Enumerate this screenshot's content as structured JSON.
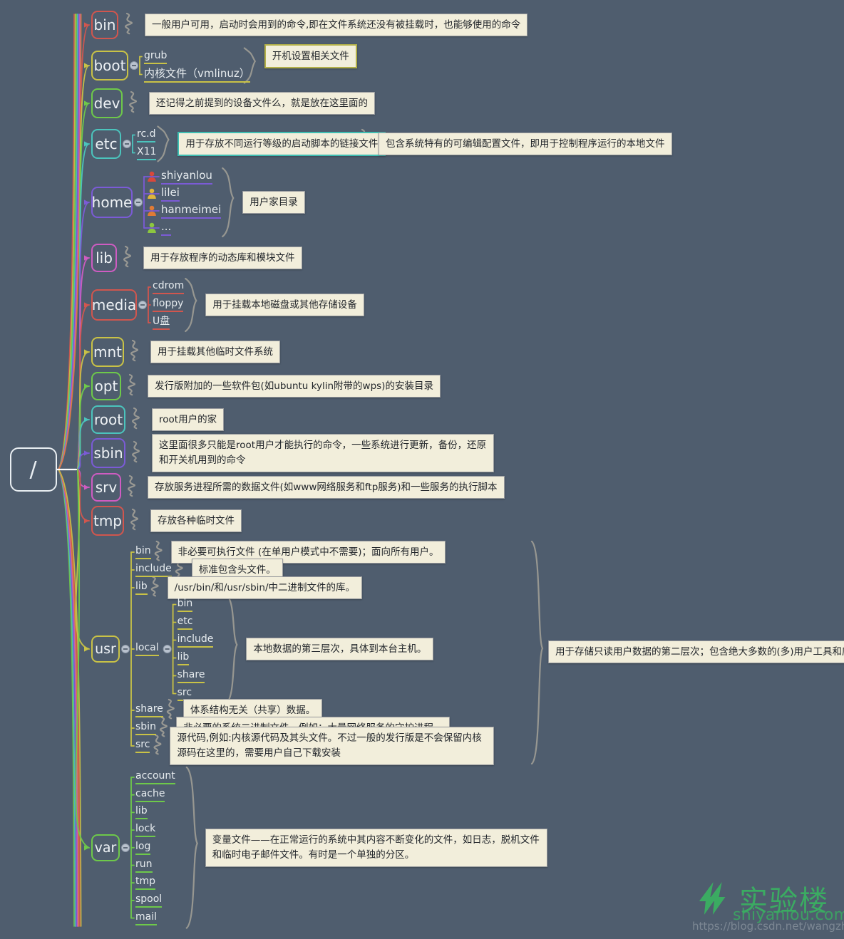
{
  "meta": {
    "background_color": "#4f5d6e",
    "root_label": "/",
    "note_fill": "#f2eedb"
  },
  "watermark": {
    "brand": "实验楼",
    "site": "shiyanlou.com",
    "blog_url": "https://blog.csdn.net/wangzhae"
  },
  "nodes": [
    {
      "id": "bin",
      "label": "bin",
      "color": "#d1564e",
      "children": [],
      "note": "一般用户可用，启动时会用到的命令,即在文件系统还没有被挂载时，也能够使用的命令",
      "note_style": "plain"
    },
    {
      "id": "boot",
      "label": "boot",
      "color": "#c9c246",
      "children": [
        "grub",
        "内核文件（vmlinuz）"
      ],
      "note": "开机设置相关文件",
      "note_style": "gold"
    },
    {
      "id": "dev",
      "label": "dev",
      "color": "#6ec94a",
      "children": [],
      "note": "还记得之前提到的设备文件么，就是放在这里面的",
      "note_style": "plain"
    },
    {
      "id": "etc",
      "label": "etc",
      "color": "#4bc4bd",
      "children": [
        "rc.d",
        "X11"
      ],
      "note": "用于存放不同运行等级的启动脚本的链接文件",
      "note_style": "teal",
      "note2": "包含系统特有的可编辑配置文件，即用于控制程序运行的本地文件",
      "note2_style": "plain"
    },
    {
      "id": "home",
      "label": "home",
      "color": "#7b5bd6",
      "children": [
        "shiyanlou",
        "lilei",
        "hanmeimei",
        "..."
      ],
      "child_icon_colors": [
        "#d8483c",
        "#e0b53c",
        "#e07b35",
        "#8cc63f"
      ],
      "note": "用户家目录",
      "note_style": "plain"
    },
    {
      "id": "lib",
      "label": "lib",
      "color": "#cf5cc2",
      "children": [],
      "note": "用于存放程序的动态库和模块文件",
      "note_style": "plain"
    },
    {
      "id": "media",
      "label": "media",
      "color": "#d1564e",
      "children": [
        "cdrom",
        "floppy",
        "U盘"
      ],
      "note": "用于挂载本地磁盘或其他存储设备",
      "note_style": "plain"
    },
    {
      "id": "mnt",
      "label": "mnt",
      "color": "#c9c246",
      "children": [],
      "note": "用于挂载其他临时文件系统",
      "note_style": "plain"
    },
    {
      "id": "opt",
      "label": "opt",
      "color": "#6ec94a",
      "children": [],
      "note": "发行版附加的一些软件包(如ubuntu kylin附带的wps)的安装目录",
      "note_style": "plain"
    },
    {
      "id": "root",
      "label": "root",
      "color": "#4bc4bd",
      "children": [],
      "note": "root用户的家",
      "note_style": "plain"
    },
    {
      "id": "sbin",
      "label": "sbin",
      "color": "#7b5bd6",
      "children": [],
      "note": "这里面很多只能是root用户才能执行的命令，一些系统进行更新，备份，还原和开关机用到的命令",
      "note_style": "plain"
    },
    {
      "id": "srv",
      "label": "srv",
      "color": "#cf5cc2",
      "children": [],
      "note": "存放服务进程所需的数据文件(如www网络服务和ftp服务)和一些服务的执行脚本",
      "note_style": "plain"
    },
    {
      "id": "tmp",
      "label": "tmp",
      "color": "#d1564e",
      "children": [],
      "note": "存放各种临时文件",
      "note_style": "plain"
    }
  ],
  "usr": {
    "label": "usr",
    "color": "#c9c246",
    "summary_note": "用于存储只读用户数据的第二层次；包含绝大多数的(多)用户工具和应用程序",
    "children": [
      {
        "label": "bin",
        "note": "非必要可执行文件 (在单用户模式中不需要)；面向所有用户。"
      },
      {
        "label": "include",
        "note": "标准包含头文件。"
      },
      {
        "label": "lib",
        "note": "/usr/bin/和/usr/sbin/中二进制文件的库。"
      },
      {
        "label": "local",
        "note": "本地数据的第三层次，具体到本台主机。",
        "children": [
          "bin",
          "etc",
          "include",
          "lib",
          "share",
          "src"
        ]
      },
      {
        "label": "share",
        "note": "体系结构无关（共享）数据。"
      },
      {
        "label": "sbin",
        "note": "非必要的系统二进制文件。例如：大量网络服务的守护进程。"
      },
      {
        "label": "src",
        "note": "源代码,例如:内核源代码及其头文件。不过一般的发行版是不会保留内核源码在这里的，需要用户自己下载安装"
      }
    ]
  },
  "var": {
    "label": "var",
    "color": "#6ec94a",
    "note": "变量文件——在正常运行的系统中其内容不断变化的文件，如日志，脱机文件和临时电子邮件文件。有时是一个单独的分区。",
    "children": [
      "account",
      "cache",
      "lib",
      "lock",
      "log",
      "run",
      "tmp",
      "spool",
      "mail"
    ]
  }
}
